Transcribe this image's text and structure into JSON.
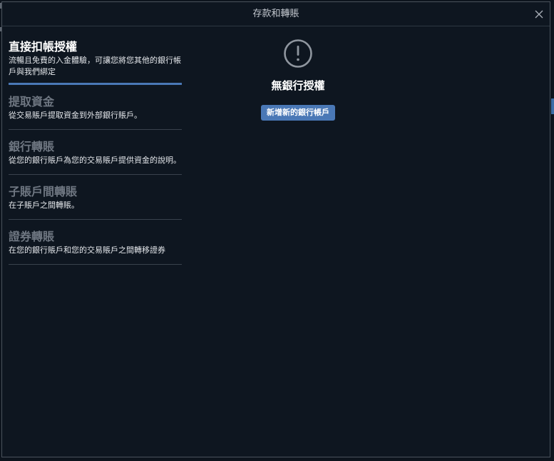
{
  "dialog": {
    "title": "存款和轉賬"
  },
  "nav": {
    "items": [
      {
        "title": "直接扣帳授權",
        "description": "流暢且免費的入金體驗，可讓您將您其他的銀行帳戶與我們綁定",
        "active": true
      },
      {
        "title": "提取資金",
        "description": "從交易賬戶提取資金到外部銀行賬戶。",
        "active": false
      },
      {
        "title": "銀行轉賬",
        "description": "從您的銀行賬戶為您的交易賬戶提供資金的說明。",
        "active": false
      },
      {
        "title": "子賬戶間轉賬",
        "description": "在子賬戶之間轉賬。",
        "active": false
      },
      {
        "title": "證券轉賬",
        "description": "在您的銀行賬戶和您的交易賬戶之間轉移證券",
        "active": false
      }
    ]
  },
  "main": {
    "icon": "exclamation-circle-icon",
    "empty_title": "無銀行授權",
    "add_button_label": "新增新的銀行帳戶"
  },
  "colors": {
    "background": "#0e1620",
    "accent": "#4a78b6",
    "muted_text": "#6f7782"
  }
}
